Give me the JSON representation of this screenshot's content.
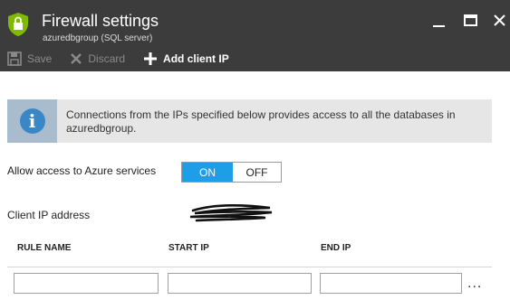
{
  "colors": {
    "header_bg": "#3c3c3c",
    "toggle_on": "#1e9ee6",
    "info_icon_bg": "#a9bccd",
    "info_bg": "#e6e6e6",
    "shield": "#7fba00"
  },
  "window": {
    "title": "Firewall settings",
    "subtitle": "azuredbgroup (SQL server)",
    "icons": {
      "app": "shield-lock-icon",
      "minimize": "minimize-icon",
      "maximize": "maximize-icon",
      "close": "close-icon"
    }
  },
  "toolbar": {
    "save_label": "Save",
    "discard_label": "Discard",
    "add_client_ip_label": "Add client IP",
    "icons": {
      "save": "save-icon",
      "discard": "discard-icon",
      "add": "plus-icon"
    }
  },
  "info": {
    "text": "Connections from the IPs specified below provides access to all the databases in azuredbgroup.",
    "icon": "info-icon",
    "icon_glyph": "i"
  },
  "azure_access": {
    "label": "Allow access to Azure services",
    "on_label": "ON",
    "off_label": "OFF",
    "selected": "ON"
  },
  "client_ip": {
    "label": "Client IP address"
  },
  "rules_table": {
    "columns": [
      "RULE NAME",
      "START IP",
      "END IP"
    ],
    "new_row": {
      "rule_name": "",
      "start_ip": "",
      "end_ip": ""
    },
    "more_label": "..."
  }
}
